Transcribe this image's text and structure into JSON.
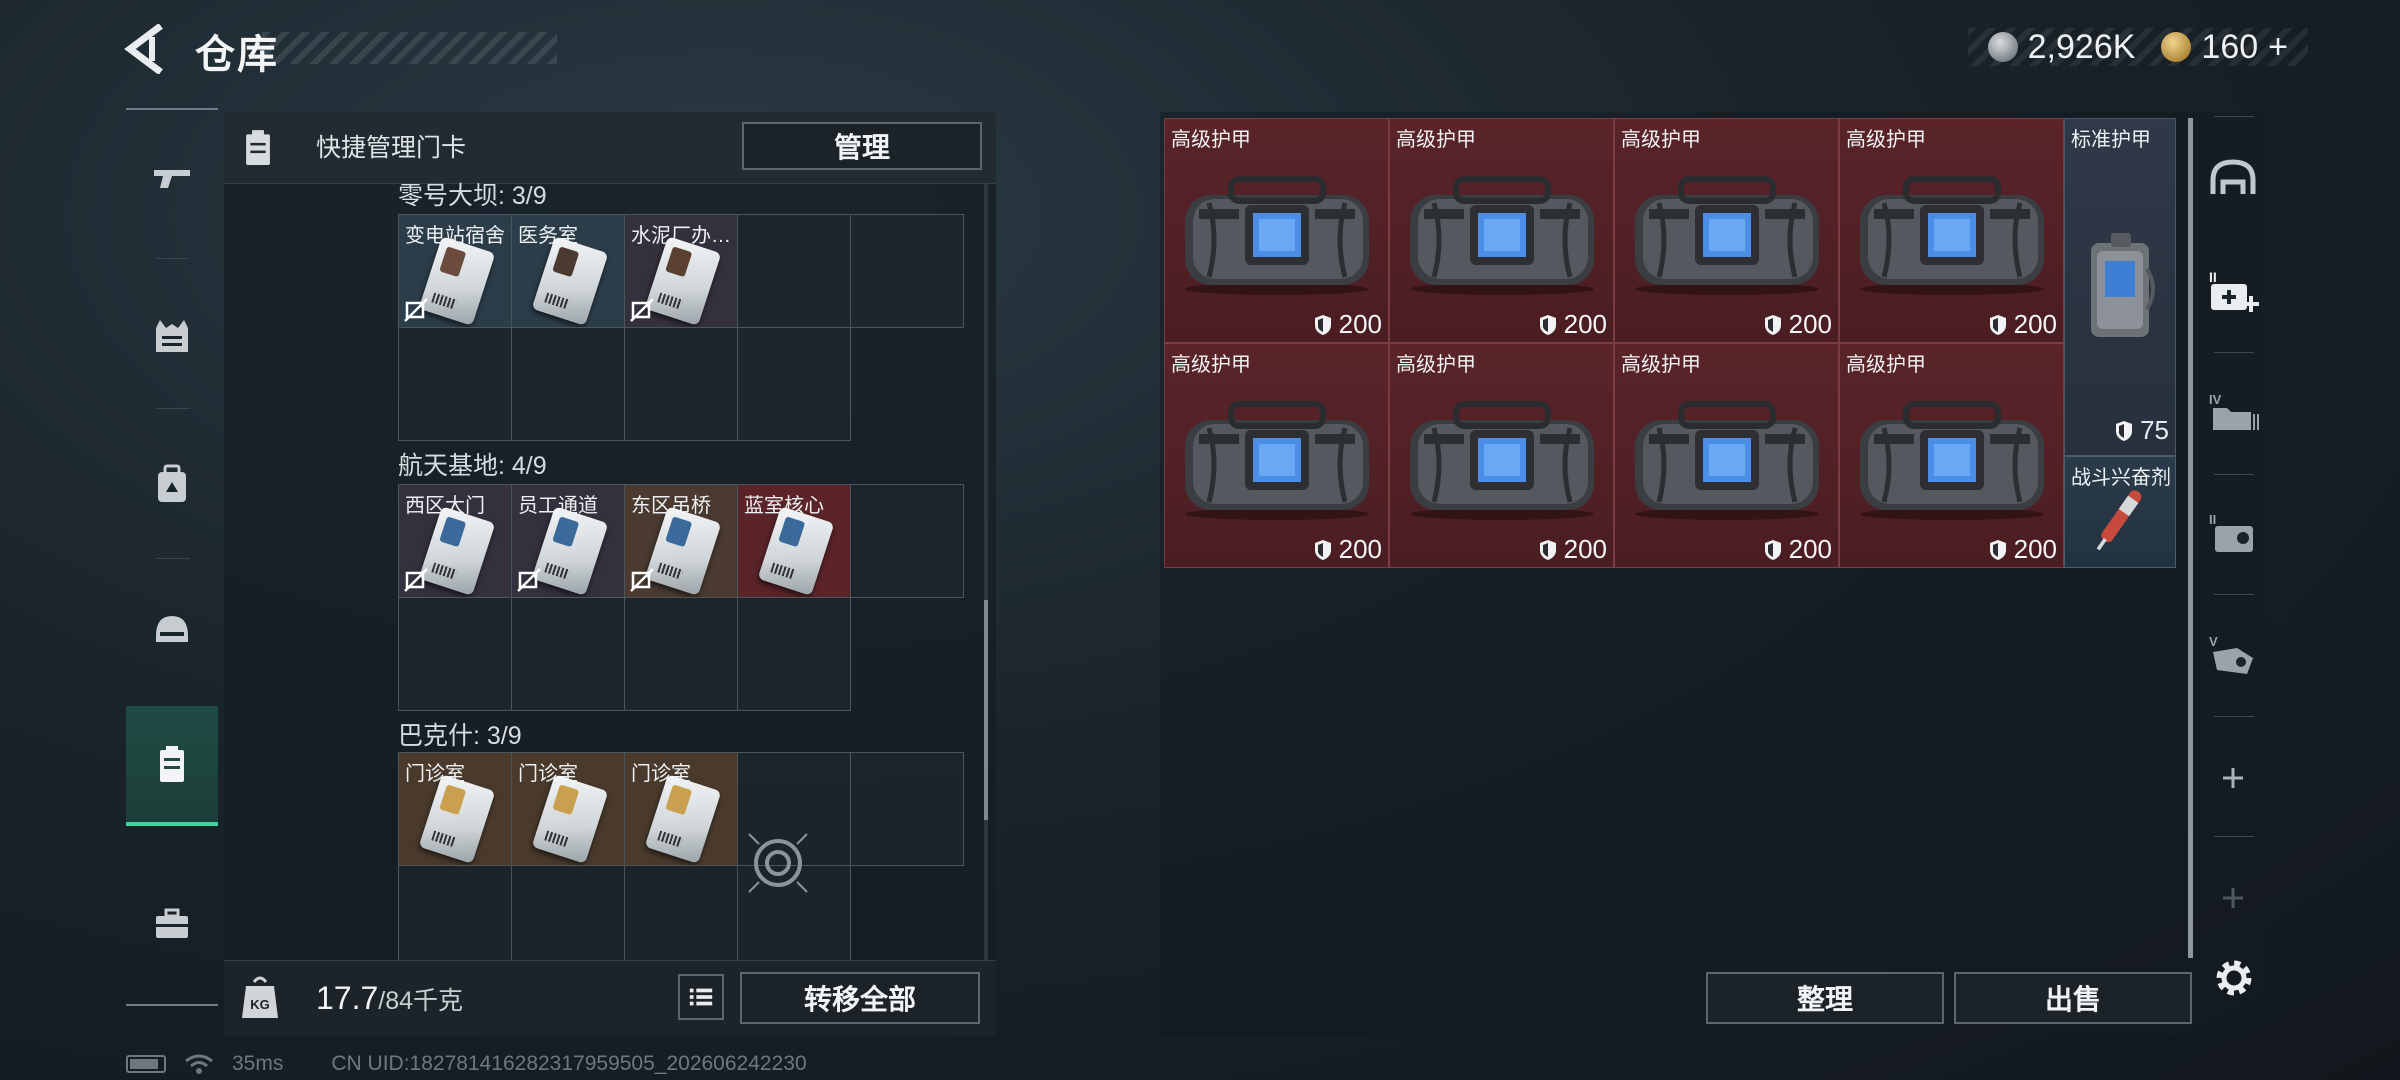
{
  "header": {
    "title": "仓库"
  },
  "currency": {
    "silver_amount": "2,926K",
    "gold_amount": "160",
    "gold_suffix": "+"
  },
  "left_nav": [
    {
      "name": "weapons",
      "icon": "gun-icon",
      "active": false
    },
    {
      "name": "armor",
      "icon": "vest-icon",
      "active": false
    },
    {
      "name": "backpack",
      "icon": "backpack-icon",
      "active": false
    },
    {
      "name": "helmet",
      "icon": "helmet-icon",
      "active": false
    },
    {
      "name": "keycards",
      "icon": "keycard-holder-icon",
      "active": true
    },
    {
      "name": "case",
      "icon": "toolbox-icon",
      "active": false
    }
  ],
  "key_panel": {
    "header_label": "快捷管理门卡",
    "manage_label": "管理",
    "groups": [
      {
        "label": "零号大坝: 3/9",
        "cards": [
          "变电站宿舍",
          "医务室",
          "水泥厂办…"
        ]
      },
      {
        "label": "航天基地: 4/9",
        "cards": [
          "西区大门",
          "员工通道",
          "东区吊桥",
          "蓝室核心"
        ]
      },
      {
        "label": "巴克什: 3/9",
        "cards": [
          "门诊室",
          "门诊室",
          "门诊室"
        ]
      }
    ],
    "weight_value": "17.7",
    "weight_max": "/84千克",
    "transfer_label": "转移全部"
  },
  "inventory": {
    "armor_items": [
      {
        "label": "高级护甲",
        "durability": "200"
      },
      {
        "label": "高级护甲",
        "durability": "200"
      },
      {
        "label": "高级护甲",
        "durability": "200"
      },
      {
        "label": "高级护甲",
        "durability": "200"
      },
      {
        "label": "高级护甲",
        "durability": "200"
      },
      {
        "label": "高级护甲",
        "durability": "200"
      },
      {
        "label": "高级护甲",
        "durability": "200"
      },
      {
        "label": "高级护甲",
        "durability": "200"
      }
    ],
    "standard_armor": {
      "label": "标准护甲",
      "durability": "75"
    },
    "stim": {
      "label": "战斗兴奋剂"
    },
    "sort_label": "整理",
    "sell_label": "出售"
  },
  "right_nav": {
    "icons": [
      "helmet-outline-icon",
      "medkit-plus-icon",
      "folder-iv-icon",
      "toolbox-ii-icon",
      "tool-v-icon",
      "plus-icon",
      "plus-icon",
      "gear-icon"
    ]
  },
  "status": {
    "ping": "35ms",
    "uid": "CN UID:18278141628231795​9505_202606242230"
  },
  "colors": {
    "accent": "#3fd49d",
    "armor_bg": "#5a2429",
    "standard_armor_bg": "#2f3948"
  }
}
